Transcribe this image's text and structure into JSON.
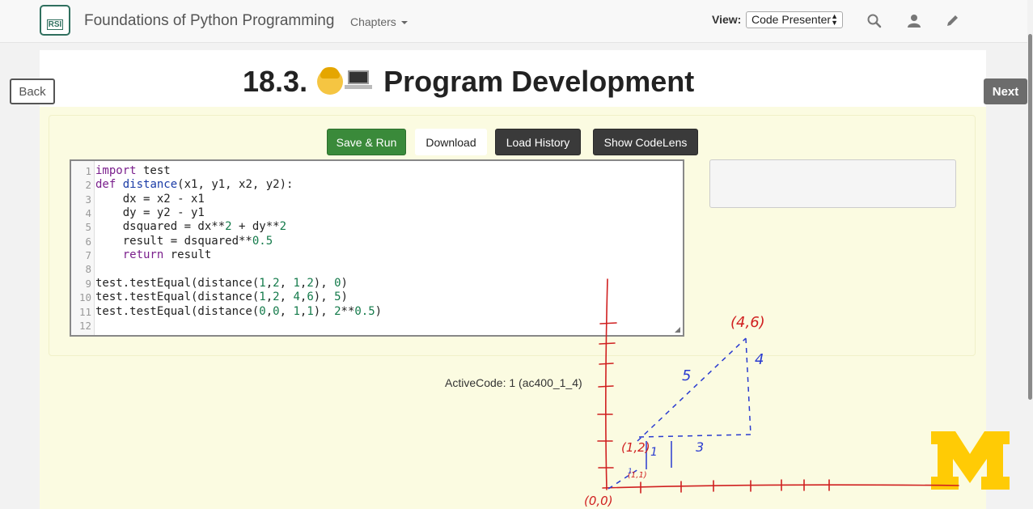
{
  "navbar": {
    "logo_text": "RSI",
    "brand": "Foundations of Python Programming",
    "chapters_label": "Chapters",
    "view_label": "View:",
    "view_value": "Code Presenter"
  },
  "page": {
    "title_number": "18.3.",
    "title_text": "Program Development",
    "back_label": "Back",
    "next_label": "Next"
  },
  "activecode": {
    "buttons": {
      "run": "Save & Run",
      "download": "Download",
      "history": "Load History",
      "codelens": "Show CodeLens"
    },
    "caption": "ActiveCode: 1 (ac400_1_4)",
    "lines": [
      {
        "n": "1",
        "text": "import test"
      },
      {
        "n": "2",
        "text": "def distance(x1, y1, x2, y2):"
      },
      {
        "n": "3",
        "text": "    dx = x2 - x1"
      },
      {
        "n": "4",
        "text": "    dy = y2 - y1"
      },
      {
        "n": "5",
        "text": "    dsquared = dx**2 + dy**2"
      },
      {
        "n": "6",
        "text": "    result = dsquared**0.5"
      },
      {
        "n": "7",
        "text": "    return result"
      },
      {
        "n": "8",
        "text": ""
      },
      {
        "n": "9",
        "text": "test.testEqual(distance(1,2, 1,2), 0)"
      },
      {
        "n": "10",
        "text": "test.testEqual(distance(1,2, 4,6), 5)"
      },
      {
        "n": "11",
        "text": "test.testEqual(distance(0,0, 1,1), 2**0.5)"
      },
      {
        "n": "12",
        "text": ""
      }
    ]
  },
  "annotations": {
    "point_a": "(4,6)",
    "point_b": "(1,2)",
    "origin": "(0,0)",
    "small_point": "(1,1)",
    "hyp": "5",
    "vert": "4",
    "horiz": "3",
    "small_vert": "1",
    "small_horiz": "1"
  },
  "colors": {
    "run_button": "#3a8a3a",
    "dark_button": "#3a3a3a",
    "yellow_bg": "#fbfbe1",
    "umich_gold": "#ffcb05",
    "ink_red": "#d02020",
    "ink_blue": "#2a3bd0"
  },
  "icons": [
    "search-icon",
    "user-icon",
    "pencil-icon",
    "caret-down-icon",
    "umich-logo"
  ]
}
